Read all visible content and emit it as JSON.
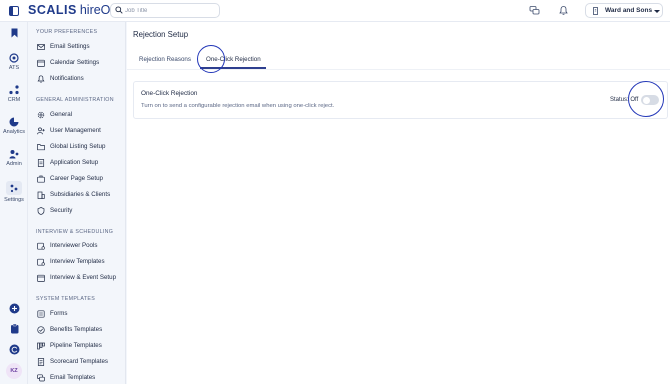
{
  "topbar": {
    "brand": "SCALIS",
    "brand_sub": "hireOS",
    "search_placeholder": "Job Title",
    "tenant_name": "Ward and Sons"
  },
  "rail": {
    "items": [
      {
        "icon": "bookmark-icon",
        "label": ""
      },
      {
        "icon": "ats-icon",
        "label": "ATS"
      },
      {
        "icon": "crm-icon",
        "label": "CRM"
      },
      {
        "icon": "analytics-icon",
        "label": "Analytics"
      },
      {
        "icon": "admin-icon",
        "label": "Admin"
      },
      {
        "icon": "settings-icon",
        "label": "Settings"
      }
    ],
    "bottom_icons": [
      "add-icon",
      "clipboard-icon",
      "refresh-icon"
    ],
    "avatar_initials": "KZ"
  },
  "menu": {
    "sections": [
      {
        "title": "YOUR PREFERENCES",
        "items": [
          "Email Settings",
          "Calendar Settings",
          "Notifications"
        ]
      },
      {
        "title": "GENERAL ADMINISTRATION",
        "items": [
          "General",
          "User Management",
          "Global Listing Setup",
          "Application Setup",
          "Career Page Setup",
          "Subsidiaries & Clients",
          "Security"
        ]
      },
      {
        "title": "INTERVIEW & SCHEDULING",
        "items": [
          "Interviewer Pools",
          "Interview Templates",
          "Interview & Event Setup"
        ]
      },
      {
        "title": "SYSTEM TEMPLATES",
        "items": [
          "Forms",
          "Benefits Templates",
          "Pipeline Templates",
          "Scorecard Templates",
          "Email Templates"
        ]
      }
    ]
  },
  "main": {
    "title": "Rejection Setup",
    "tabs": [
      "Rejection Reasons",
      "One-Click Rejection"
    ],
    "active_tab": "One-Click Rejection",
    "card": {
      "title": "One-Click Rejection",
      "description": "Turn on to send a configurable rejection email when using one-click reject.",
      "status_label": "Status: Off",
      "toggle_on": false
    }
  },
  "colors": {
    "brand": "#1f3a8a",
    "accent": "#2e3f8f",
    "highlight": "#2337b8"
  }
}
